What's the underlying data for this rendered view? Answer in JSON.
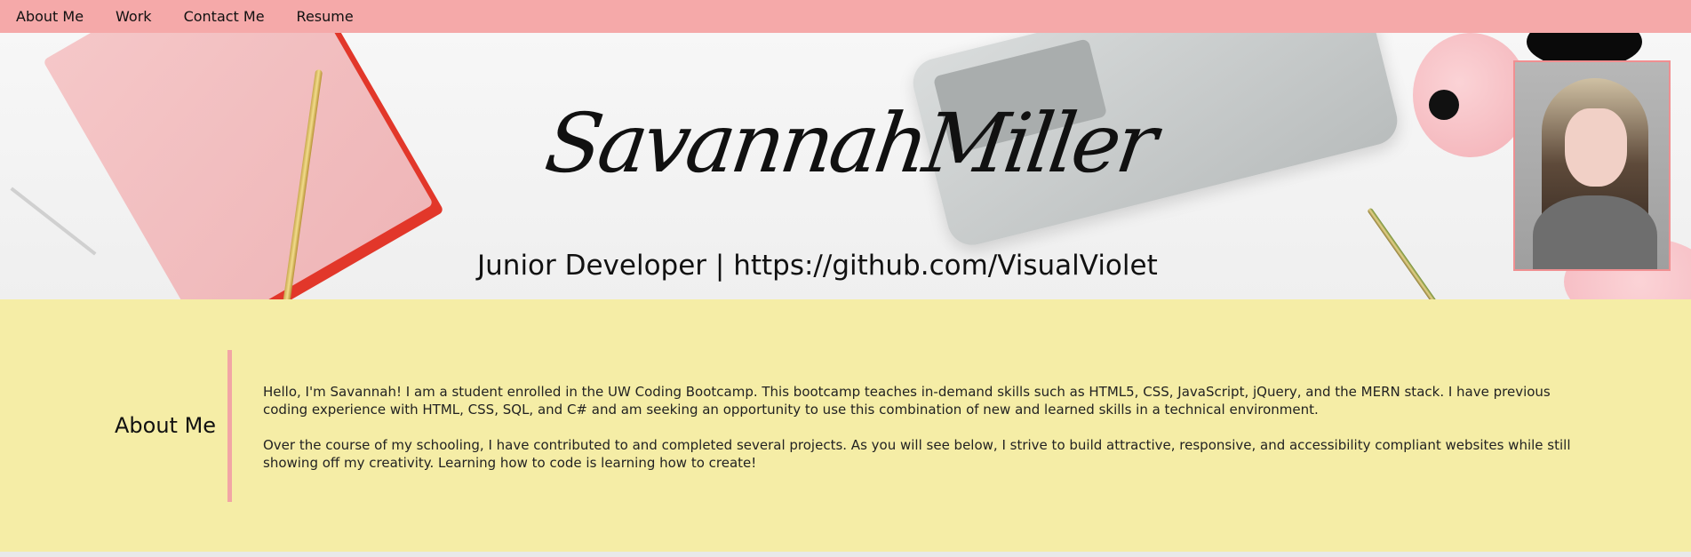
{
  "nav": {
    "items": [
      {
        "label": "About Me"
      },
      {
        "label": "Work"
      },
      {
        "label": "Contact Me"
      },
      {
        "label": "Resume"
      }
    ]
  },
  "hero": {
    "name": "SavannahMiller",
    "subtitle": "Junior Developer | https://github.com/VisualViolet"
  },
  "about": {
    "heading": "About Me",
    "paragraphs": [
      "Hello, I'm Savannah! I am a student enrolled in the UW Coding Bootcamp. This bootcamp teaches in-demand skills such as HTML5, CSS, JavaScript, jQuery, and the MERN stack. I have previous coding experience with HTML, CSS, SQL, and C# and am seeking an opportunity to use this combination of new and learned skills in a technical environment.",
      "Over the course of my schooling, I have contributed to and completed several projects. As you will see below, I strive to build attractive, responsive, and accessibility compliant websites while still showing off my creativity. Learning how to code is learning how to create!"
    ]
  },
  "colors": {
    "nav_bg": "#f5a9a9",
    "about_bg": "#f5eda6",
    "accent": "#f2a5a5"
  }
}
